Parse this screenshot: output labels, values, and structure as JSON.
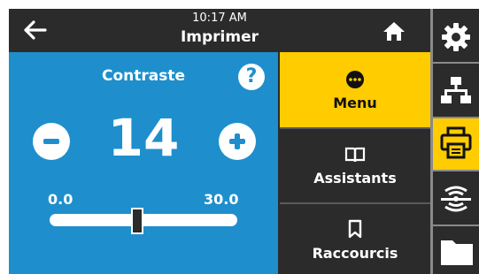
{
  "header": {
    "time": "10:17 AM",
    "title": "Imprimer",
    "back_icon": "arrow-left-icon",
    "home_icon": "home-icon"
  },
  "setting": {
    "title": "Contraste",
    "value": "14",
    "min": "0.0",
    "max": "30.0",
    "level": 14,
    "range": [
      0,
      30
    ]
  },
  "menu": [
    {
      "label": "Menu",
      "icon": "dots-menu-icon",
      "selected": true
    },
    {
      "label": "Assistants",
      "icon": "book-icon"
    },
    {
      "label": "Raccourcis",
      "icon": "bookmark-icon"
    }
  ],
  "sidebar": [
    {
      "icon": "gear-icon"
    },
    {
      "icon": "network-icon"
    },
    {
      "icon": "printer-icon",
      "selected": true
    },
    {
      "icon": "media-sensor-icon"
    },
    {
      "icon": "folder-icon"
    }
  ],
  "colors": {
    "panel": "#1e8fcc",
    "accent": "#ffcc00",
    "dark": "#2b2b2b"
  }
}
